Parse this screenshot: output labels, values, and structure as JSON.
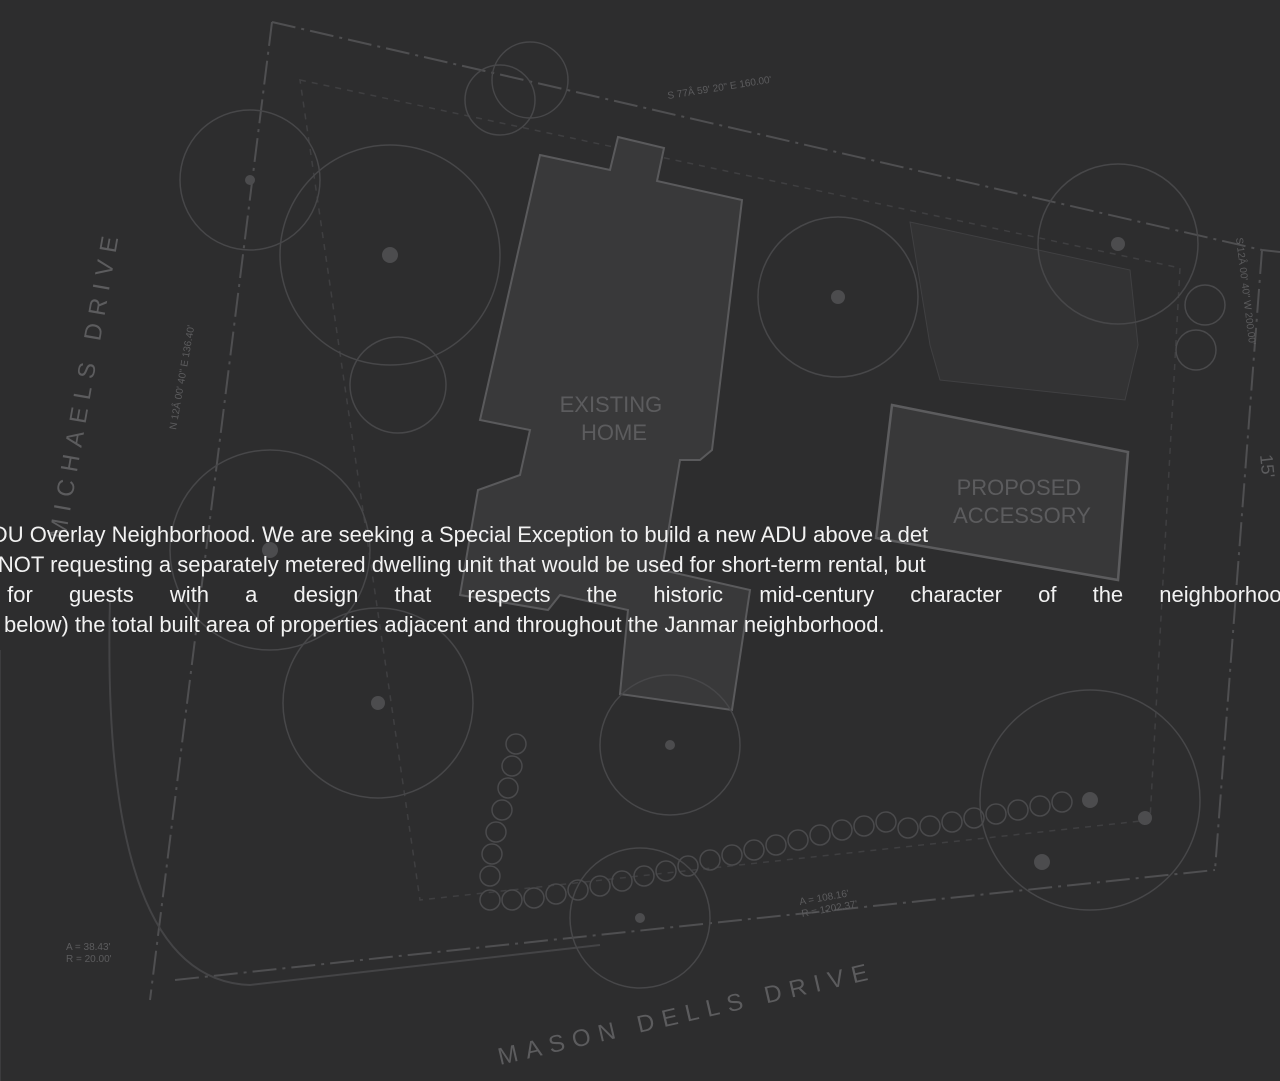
{
  "site_plan": {
    "colors": {
      "background": "#2d2d2e",
      "linework": "#4a4a4c",
      "building_fill": "#3a3a3b",
      "label": "#5c5c5e",
      "overlay_text": "#f2f2f2"
    },
    "labels": {
      "existing_home": [
        "EXISTING",
        "HOME"
      ],
      "proposed_accessory": [
        "PROPOSED",
        "ACCESSORY"
      ],
      "street_bottom": "MASON DELLS DRIVE",
      "street_left": "MICHAELS DRIVE",
      "bearing_top": "S 77Â 59' 20\" E 160.00'",
      "bearing_left": "N 12Â 00' 40\" E 136.40'",
      "bearing_right": "S 12Â 00' 40\" W 200.00'",
      "curve_left_a": "A = 38.43'",
      "curve_left_r": "R = 20.00'",
      "curve_bottom_a": "A = 108.16'",
      "curve_bottom_r": "R = 1202.37'",
      "setback_right": "15'"
    }
  },
  "overlay": {
    "lines": [
      "n ADU Overlay Neighborhood. We are seeking a Special Exception to build a new ADU above a det",
      "are NOT requesting a separately metered dwelling unit that would be used for short-term rental, but",
      "it for guests with a design that respects the historic mid-century character of the neighborhood,",
      "well below) the total built area of properties adjacent and throughout the Janmar neighborhood."
    ]
  }
}
